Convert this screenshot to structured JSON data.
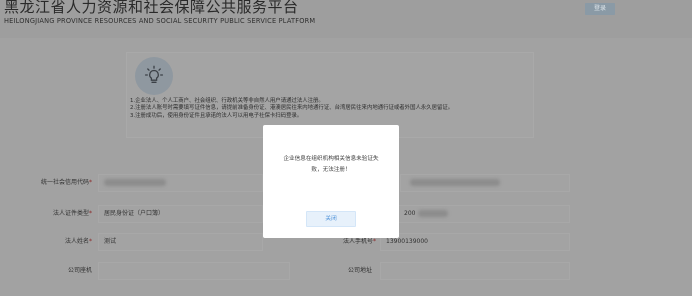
{
  "header": {
    "title_cn": "黑龙江省人力资源和社会保障公共服务平台",
    "title_en": "HEILONGJIANG PROVINCE RESOURCES AND SOCIAL SECURITY PUBLIC SERVICE PLATFORM",
    "login_label": "登录"
  },
  "info": {
    "icon": "lightbulb-icon",
    "notes": [
      "1.企业法人、个人工商户、社会组织、行政机关等非自然人用户请通过法人注册。",
      "2.注册法人账号时需要填写证件信息，请提前准备身份证、港澳居民往来内地通行证、台湾居民往来内地通行证或者外国人永久居留证。",
      "3.注册成功后，使用身份证件且承诺的法人可以用电子社保卡扫码登录。"
    ]
  },
  "form": {
    "credit_code_label": "统一社会信用代码",
    "credit_code_value": "",
    "legal_id_type_label": "法人证件类型",
    "legal_id_type_value": "居民身份证（户口簿）",
    "legal_id_number_value": "200",
    "legal_name_label": "法人姓名",
    "legal_name_value": "测试",
    "legal_phone_label": "法人手机号",
    "legal_phone_value": "13900139000",
    "company_phone_label": "公司座机",
    "company_address_label": "公司地址",
    "required_mark": "*"
  },
  "modal": {
    "message_line1": "企业信息在组织机构相关信息未验证失",
    "message_line2": "败，无法注册！",
    "close_label": "关闭"
  }
}
